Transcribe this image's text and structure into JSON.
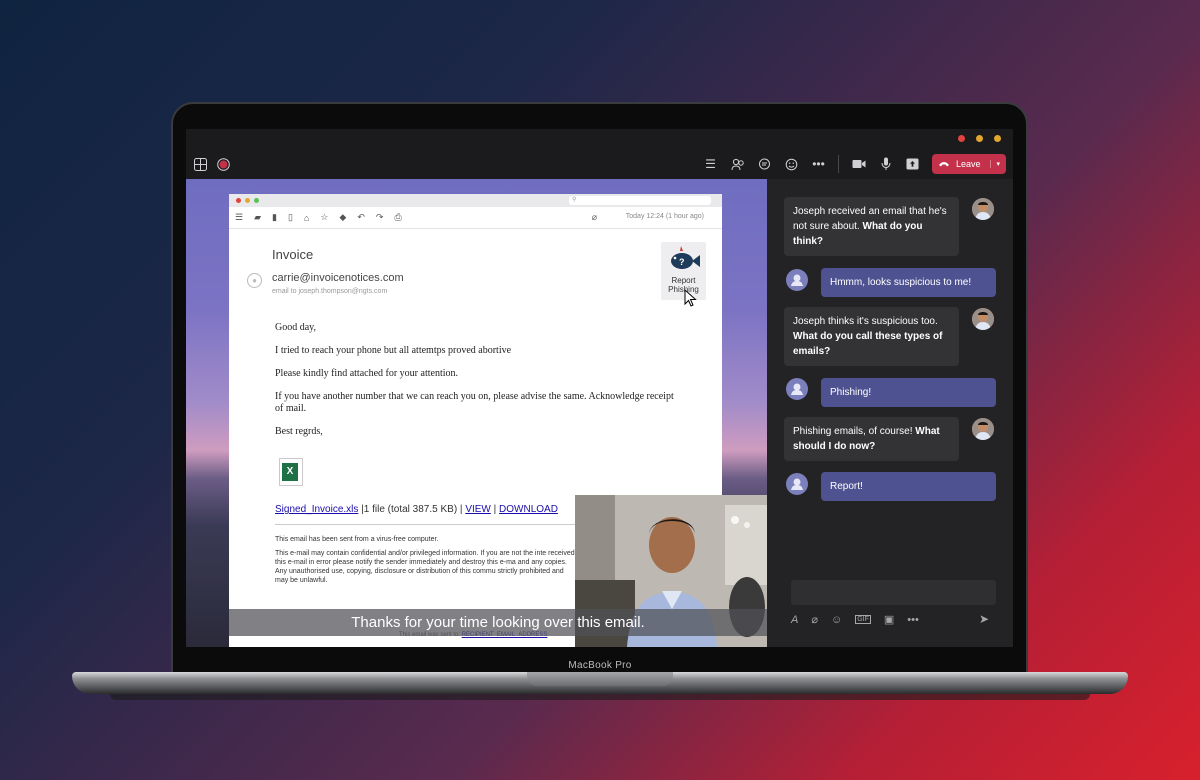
{
  "device": {
    "label": "MacBook Pro"
  },
  "colors": {
    "leave": "#c4314b",
    "bubble_out": "#4f5291",
    "bubble_in": "#333335"
  },
  "toolbar": {
    "left_icons": [
      "apps-grid-icon",
      "record-icon"
    ],
    "right_icons": [
      "list-icon",
      "people-icon",
      "chat-icon",
      "reactions-icon",
      "more-icon",
      "camera-icon",
      "mic-icon",
      "share-icon"
    ],
    "leave_label": "Leave"
  },
  "email": {
    "search_placeholder": "",
    "date": "Today 12:24 (1 hour ago)",
    "subject": "Invoice",
    "from": "carrie@invoicenotices.com",
    "to": "email to joseph.thompson@ngts.com",
    "report_label": "Report Phishing",
    "body": [
      "Good day,",
      "I tried to reach your phone but all attemtps proved abortive",
      "Please kindly find attached for your attention.",
      "If you have another number that we can reach you on, please advise the same. Acknowledge receipt of mail.",
      "Best regrds,"
    ],
    "attachment": {
      "name": "Signed_Invoice.xls",
      "info": " |1 file (total 387.5 KB) | ",
      "view": "VIEW",
      "sep": " | ",
      "download": "DOWNLOAD"
    },
    "disclaimer": [
      "This email has been sent from a virus-free computer.",
      "This e-mail may contain confidential and/or privileged information. If you are not the inte received this e-mail in error please notify the sender immediately and destroy this e-ma and any copies. Any unauthorised use, copying, disclosure or distribution of this commu strictly prohibited and may be unlawful."
    ],
    "footer_prefix": "This email was sent to: ",
    "footer_link": "RECIPIENT_EMAIL_ADDRESS"
  },
  "video": {
    "caption": "Thanks for your time looking over this email."
  },
  "chat": {
    "messages": [
      {
        "from": "joseph",
        "text": "Joseph received an email that he's not sure about. ",
        "bold": "What do you think?"
      },
      {
        "from": "me",
        "text": "Hmmm, looks suspicious to me!",
        "bold": ""
      },
      {
        "from": "joseph",
        "text": "Joseph thinks it's suspicious too. ",
        "bold": "What do you call these types of emails?"
      },
      {
        "from": "me",
        "text": "Phishing!",
        "bold": ""
      },
      {
        "from": "joseph",
        "text": "Phishing emails, of course! ",
        "bold": "What should I do now?"
      },
      {
        "from": "me",
        "text": "Report!",
        "bold": ""
      }
    ],
    "compose_placeholder": ""
  }
}
